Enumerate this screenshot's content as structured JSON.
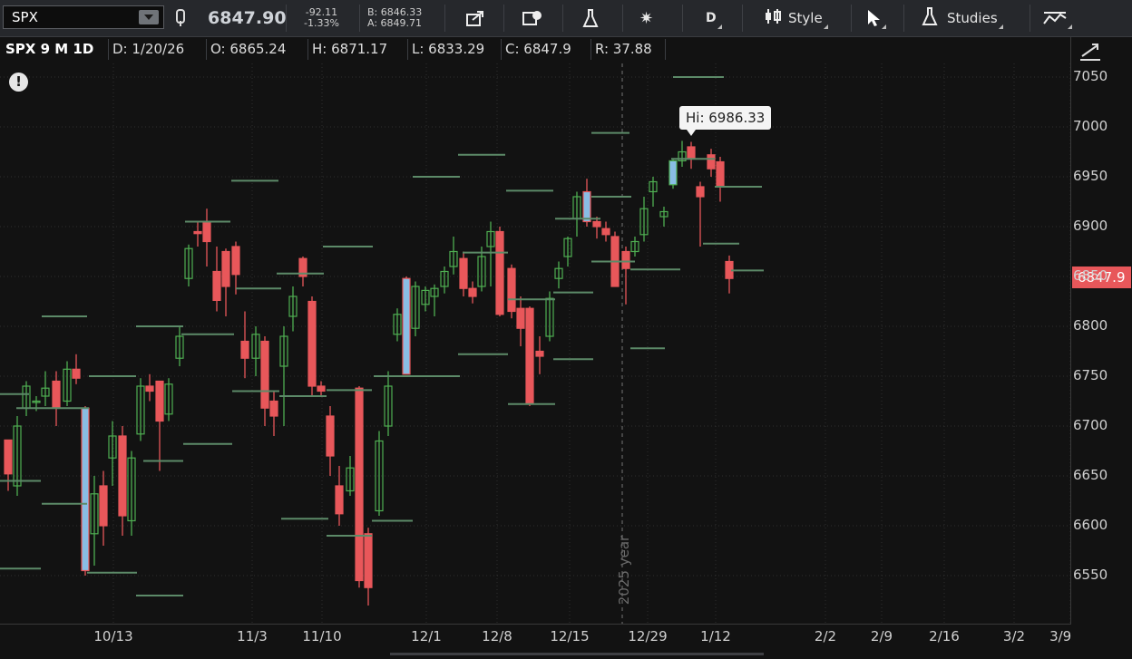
{
  "toolbar": {
    "symbol": "SPX",
    "last": "6847.90",
    "change": "-92.11",
    "change_pct": "-1.33%",
    "bid": "B: 6846.33",
    "ask": "A: 6849.71",
    "aggregation": "D",
    "style_label": "Style",
    "studies_label": "Studies",
    "colors": {
      "down": "#e8575a",
      "up": "#4fae52",
      "accent": "#4a90c8"
    }
  },
  "info": {
    "title": "SPX 9 M 1D",
    "date": "D: 1/20/26",
    "open": "O: 6865.24",
    "high": "H: 6871.17",
    "low": "L: 6833.29",
    "close": "C: 6847.9",
    "range": "R: 37.88"
  },
  "hi_label": "Hi: 6986.33",
  "last_price_tag": "6847.9",
  "year_marker": "2025 year",
  "chart_data": {
    "type": "candlestick",
    "y_ticks": [
      "7050",
      "7000",
      "6950",
      "6900",
      "6850",
      "6800",
      "6750",
      "6700",
      "6650",
      "6600",
      "6550"
    ],
    "x_ticks": [
      "10/13",
      "11/3",
      "11/10",
      "12/1",
      "12/8",
      "12/15",
      "12/29",
      "1/12",
      "2/2",
      "2/9",
      "2/16",
      "3/2",
      "3/9"
    ],
    "ylim": [
      6500,
      7060
    ],
    "grid": true,
    "last_price": 6847.9,
    "session_high": 6986.33
  }
}
